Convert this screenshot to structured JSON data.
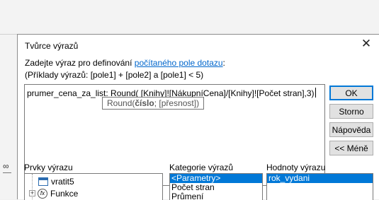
{
  "dialog": {
    "title": "Tvůrce výrazů",
    "instruction_prefix": "Zadejte výraz pro definování ",
    "instruction_link": "počítaného pole dotazu",
    "instruction_suffix": ":",
    "example": "(Příklady výrazů: [pole1] + [pole2] a [pole1] < 5)"
  },
  "expression": {
    "value": "prumer_cena_za_list: Round( [Knihy]![NákupníCena]/[Knihy]![Počet stran],3)",
    "tooltip_func": "Round(",
    "tooltip_arg_bold": "číslo",
    "tooltip_rest": "; [přesnost])"
  },
  "buttons": {
    "ok": "OK",
    "cancel": "Storno",
    "help": "Nápověda",
    "less": "<< Méně"
  },
  "elements": {
    "label": "Prvky výrazu",
    "items": [
      {
        "label": "vratit5",
        "icon": "table-icon"
      },
      {
        "label": "Funkce",
        "icon": "function-icon"
      }
    ]
  },
  "categories": {
    "label": "Kategorie výrazů",
    "items": [
      "<Parametry>",
      "Počet stran",
      "Průmení"
    ],
    "selected_index": 0
  },
  "values": {
    "label": "Hodnoty výrazu",
    "items": [
      "rok_vydani"
    ],
    "selected_index": 0
  }
}
